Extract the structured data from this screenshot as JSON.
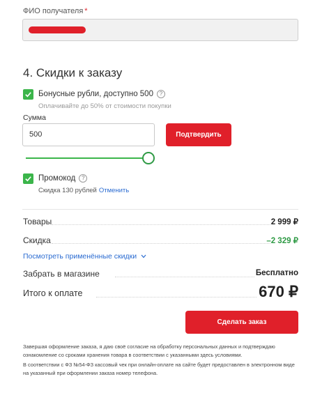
{
  "recipient": {
    "label": "ФИО получателя",
    "required_mark": "*",
    "value_redacted": true
  },
  "section": {
    "title": "4. Скидки к заказу"
  },
  "bonus": {
    "checked": true,
    "label": "Бонусные рубли, доступно 500",
    "help_icon": "?",
    "hint": "Оплачивайте до 50% от стоимости покупки",
    "sum_label": "Сумма",
    "sum_value": "500",
    "confirm_label": "Подтвердить",
    "slider_fraction": 1.0
  },
  "promo": {
    "checked": true,
    "label": "Промокод",
    "help_icon": "?",
    "discount_text": "Скидка 130 рублей",
    "cancel_link": "Отменить"
  },
  "summary": {
    "goods_label": "Товары",
    "goods_value": "2 999 ₽",
    "discount_label": "Скидка",
    "discount_value": "–2 329 ₽",
    "show_discounts_link": "Посмотреть применённые скидки",
    "pickup_label": "Забрать в магазине",
    "pickup_value": "Бесплатно",
    "total_label": "Итого к оплате",
    "total_value": "670 ₽"
  },
  "order_button": "Сделать заказ",
  "legal": {
    "paragraph1": "Завершая оформление заказа, я даю своё согласие на обработку персональных данных и подтверждаю ознакомление со сроками хранения товара в соответствии с указанными здесь условиями.",
    "paragraph2": "В соответствии с ФЗ №54-ФЗ кассовый чек при онлайн-оплате на сайте будет предоставлен в электронном виде на указанный при оформлении заказа номер телефона."
  },
  "colors": {
    "accent_red": "#e0202a",
    "check_green": "#3bb54a",
    "link_blue": "#2a6bd1",
    "discount_green": "#2f9a45"
  }
}
